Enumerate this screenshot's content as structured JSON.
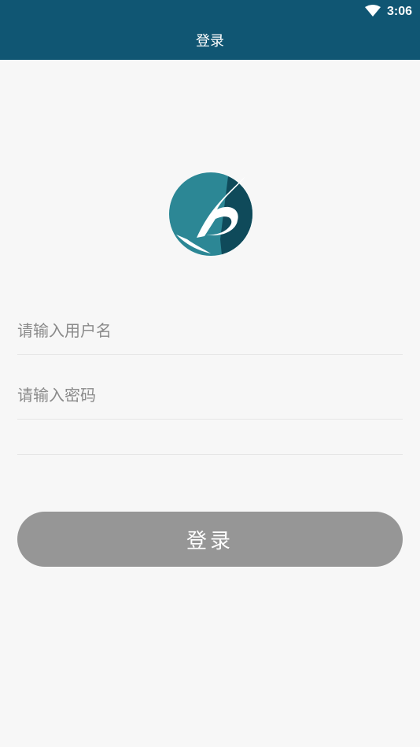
{
  "status_bar": {
    "time": "3:06",
    "wifi_icon": "wifi-icon"
  },
  "header": {
    "title": "登录"
  },
  "logo": {
    "icon": "b-logo-icon",
    "colors": {
      "primary": "#2c8795",
      "dark": "#0f4a5a"
    }
  },
  "form": {
    "username_placeholder": "请输入用户名",
    "password_placeholder": "请输入密码",
    "login_label": "登录"
  },
  "colors": {
    "topbar": "#105673",
    "background": "#f7f7f7",
    "button": "#969696"
  }
}
